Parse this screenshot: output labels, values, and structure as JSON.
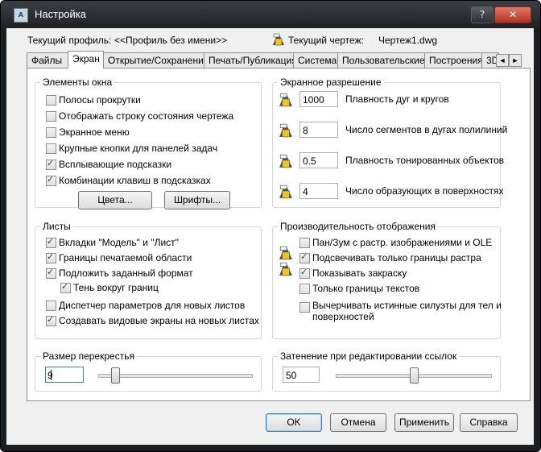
{
  "window": {
    "title": "Настройка",
    "icon_text": "A",
    "help_label": "?",
    "close_label": "✕"
  },
  "header": {
    "profile_label": "Текущий профиль:",
    "profile_value": "<<Профиль без имени>>",
    "drawing_label": "Текущий чертеж:",
    "drawing_value": "Чертеж1.dwg"
  },
  "tabs": [
    {
      "label": "Файлы",
      "active": false
    },
    {
      "label": "Экран",
      "active": true
    },
    {
      "label": "Открытие/Сохранение",
      "active": false
    },
    {
      "label": "Печать/Публикация",
      "active": false
    },
    {
      "label": "Система",
      "active": false
    },
    {
      "label": "Пользовательские",
      "active": false
    },
    {
      "label": "Построения",
      "active": false
    },
    {
      "label": "3D",
      "active": false
    }
  ],
  "tab_scroll": {
    "left": "◄",
    "right": "►"
  },
  "window_elements": {
    "title": "Элементы окна",
    "options": [
      {
        "label": "Полосы прокрутки",
        "checked": false
      },
      {
        "label": "Отображать строку состояния чертежа",
        "checked": false
      },
      {
        "label": "Экранное меню",
        "checked": false
      },
      {
        "label": "Крупные кнопки для панелей задач",
        "checked": false
      },
      {
        "label": "Всплывающие подсказки",
        "checked": true
      },
      {
        "label": "Комбинации клавиш в подсказках",
        "checked": true
      }
    ],
    "colors_button": "Цвета...",
    "fonts_button": "Шрифты..."
  },
  "resolution": {
    "title": "Экранное разрешение",
    "rows": [
      {
        "value": "1000",
        "label": "Плавность дуг и кругов"
      },
      {
        "value": "8",
        "label": "Число сегментов в дугах полилиний"
      },
      {
        "value": "0.5",
        "label": "Плавность тонированных объектов"
      },
      {
        "value": "4",
        "label": "Число образующих в поверхностях"
      }
    ]
  },
  "layouts": {
    "title": "Листы",
    "options": [
      {
        "label": "Вкладки \"Модель\" и \"Лист\"",
        "checked": true
      },
      {
        "label": "Границы печатаемой области",
        "checked": true
      },
      {
        "label": "Подложить заданный формат",
        "checked": true
      },
      {
        "label": "Тень вокруг границ",
        "checked": true
      },
      {
        "label": "Диспетчер параметров для новых листов",
        "checked": false
      },
      {
        "label": "Создавать видовые экраны на новых листах",
        "checked": true
      }
    ]
  },
  "performance": {
    "title": "Производительность отображения",
    "options": [
      {
        "label": "Пан/Зум с растр. изображениями и OLE",
        "checked": false
      },
      {
        "label": "Подсвечивать только границы растра",
        "checked": true
      },
      {
        "label": "Показывать закраску",
        "checked": true
      },
      {
        "label": "Только границы текстов",
        "checked": false
      },
      {
        "label_line1": "Вычерчивать истинные силуэты для тел и",
        "label_line2": "поверхностей",
        "checked": false
      }
    ]
  },
  "crosshair": {
    "title": "Размер перекрестья",
    "value": "9",
    "slider_fraction": 0.09
  },
  "xref_fading": {
    "title": "Затенение при редактировании ссылок",
    "value": "50",
    "slider_fraction": 0.5
  },
  "footer": {
    "ok": "OK",
    "cancel": "Отмена",
    "apply": "Применить",
    "help": "Справка"
  }
}
